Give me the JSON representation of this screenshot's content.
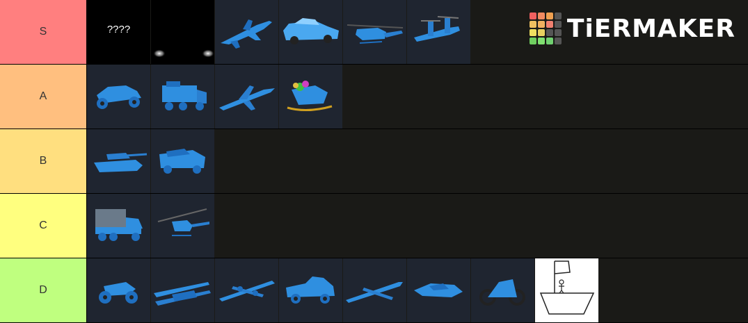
{
  "brand": {
    "name": "TiERMAKER",
    "grid_colors": [
      "#f06060",
      "#f28a60",
      "#f0a050",
      "#555555",
      "#f0c060",
      "#f0b060",
      "#f08070",
      "#555555",
      "#f0e060",
      "#e8d060",
      "#555555",
      "#555555",
      "#70d060",
      "#80e070",
      "#70d070",
      "#555555"
    ]
  },
  "tiers": [
    {
      "label": "S",
      "color": "#ff7f7f",
      "items": [
        "???? (hidden)",
        "dark car with headlights",
        "fighter jet",
        "sports car",
        "helicopter",
        "tiltrotor aircraft"
      ]
    },
    {
      "label": "A",
      "color": "#ffbf7f",
      "items": [
        "dune buggy",
        "armored truck",
        "attack jet",
        "sleigh"
      ]
    },
    {
      "label": "B",
      "color": "#ffdf7f",
      "items": [
        "tank",
        "humvee"
      ]
    },
    {
      "label": "C",
      "color": "#ffff7f",
      "items": [
        "cargo truck",
        "light helicopter"
      ]
    },
    {
      "label": "D",
      "color": "#bfff7f",
      "items": [
        "quad bike",
        "biplane",
        "twin engine plane",
        "pickup truck",
        "transport plane",
        "hover bike",
        "dirt bike",
        "boat drawing"
      ]
    }
  ],
  "hidden_text": "????"
}
